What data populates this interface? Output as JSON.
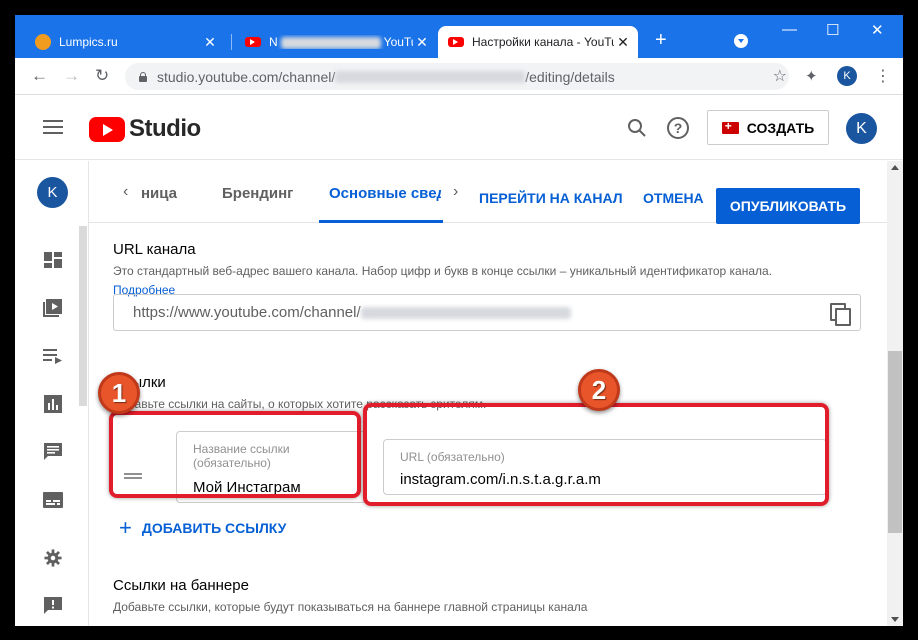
{
  "browser": {
    "tabs": [
      {
        "title": "Lumpics.ru",
        "close": "✕"
      },
      {
        "title": "N",
        "suffix": "YouTu",
        "close": "✕"
      },
      {
        "title": "Настройки канала - YouTube",
        "close": "✕"
      }
    ],
    "new_tab": "+",
    "window_controls": {
      "minimize": "—",
      "maximize": "☐",
      "close": "✕"
    },
    "nav": {
      "back": "←",
      "forward": "→",
      "reload": "↻"
    },
    "url_prefix": "studio.youtube.com/channel/",
    "url_suffix": "/editing/details",
    "profile_letter": "K",
    "bookmark_star": "☆",
    "menu": "⋮",
    "extensions": "✦"
  },
  "header": {
    "logo_text": "Studio",
    "create_label": "СОЗДАТЬ",
    "avatar_letter": "K",
    "help_glyph": "?"
  },
  "rail": {
    "avatar_letter": "K"
  },
  "channel_tabs": {
    "prev_arrow": "‹",
    "next_arrow": "›",
    "tab_partial": "ница",
    "tab_branding": "Брендинг",
    "tab_basic": "Основные сведе",
    "go_to_channel": "ПЕРЕЙТИ НА КАНАЛ",
    "cancel": "ОТМЕНА",
    "publish": "ОПУБЛИКОВАТЬ"
  },
  "url_section": {
    "title": "URL канала",
    "description": "Это стандартный веб-адрес вашего канала. Набор цифр и букв в конце ссылки – уникальный идентификатор канала.",
    "more": "Подробнее",
    "value_prefix": "https://www.youtube.com/channel/"
  },
  "links_section": {
    "title": "Ссылки",
    "description": "Добавьте ссылки на сайты, о которых хотите рассказать зрителям.",
    "name_label": "Название ссылки (обязательно)",
    "name_value": "Мой Инстаграм",
    "url_label": "URL (обязательно)",
    "url_value": "instagram.com/i.n.s.t.a.g.r.a.m",
    "add_link": "ДОБАВИТЬ ССЫЛКУ",
    "add_plus": "+"
  },
  "banner_section": {
    "title": "Ссылки на баннере",
    "description": "Добавьте ссылки, которые будут показываться на баннере главной страницы канала"
  },
  "annotations": {
    "badge1": "1",
    "badge2": "2",
    "color": "#e11d2b"
  }
}
